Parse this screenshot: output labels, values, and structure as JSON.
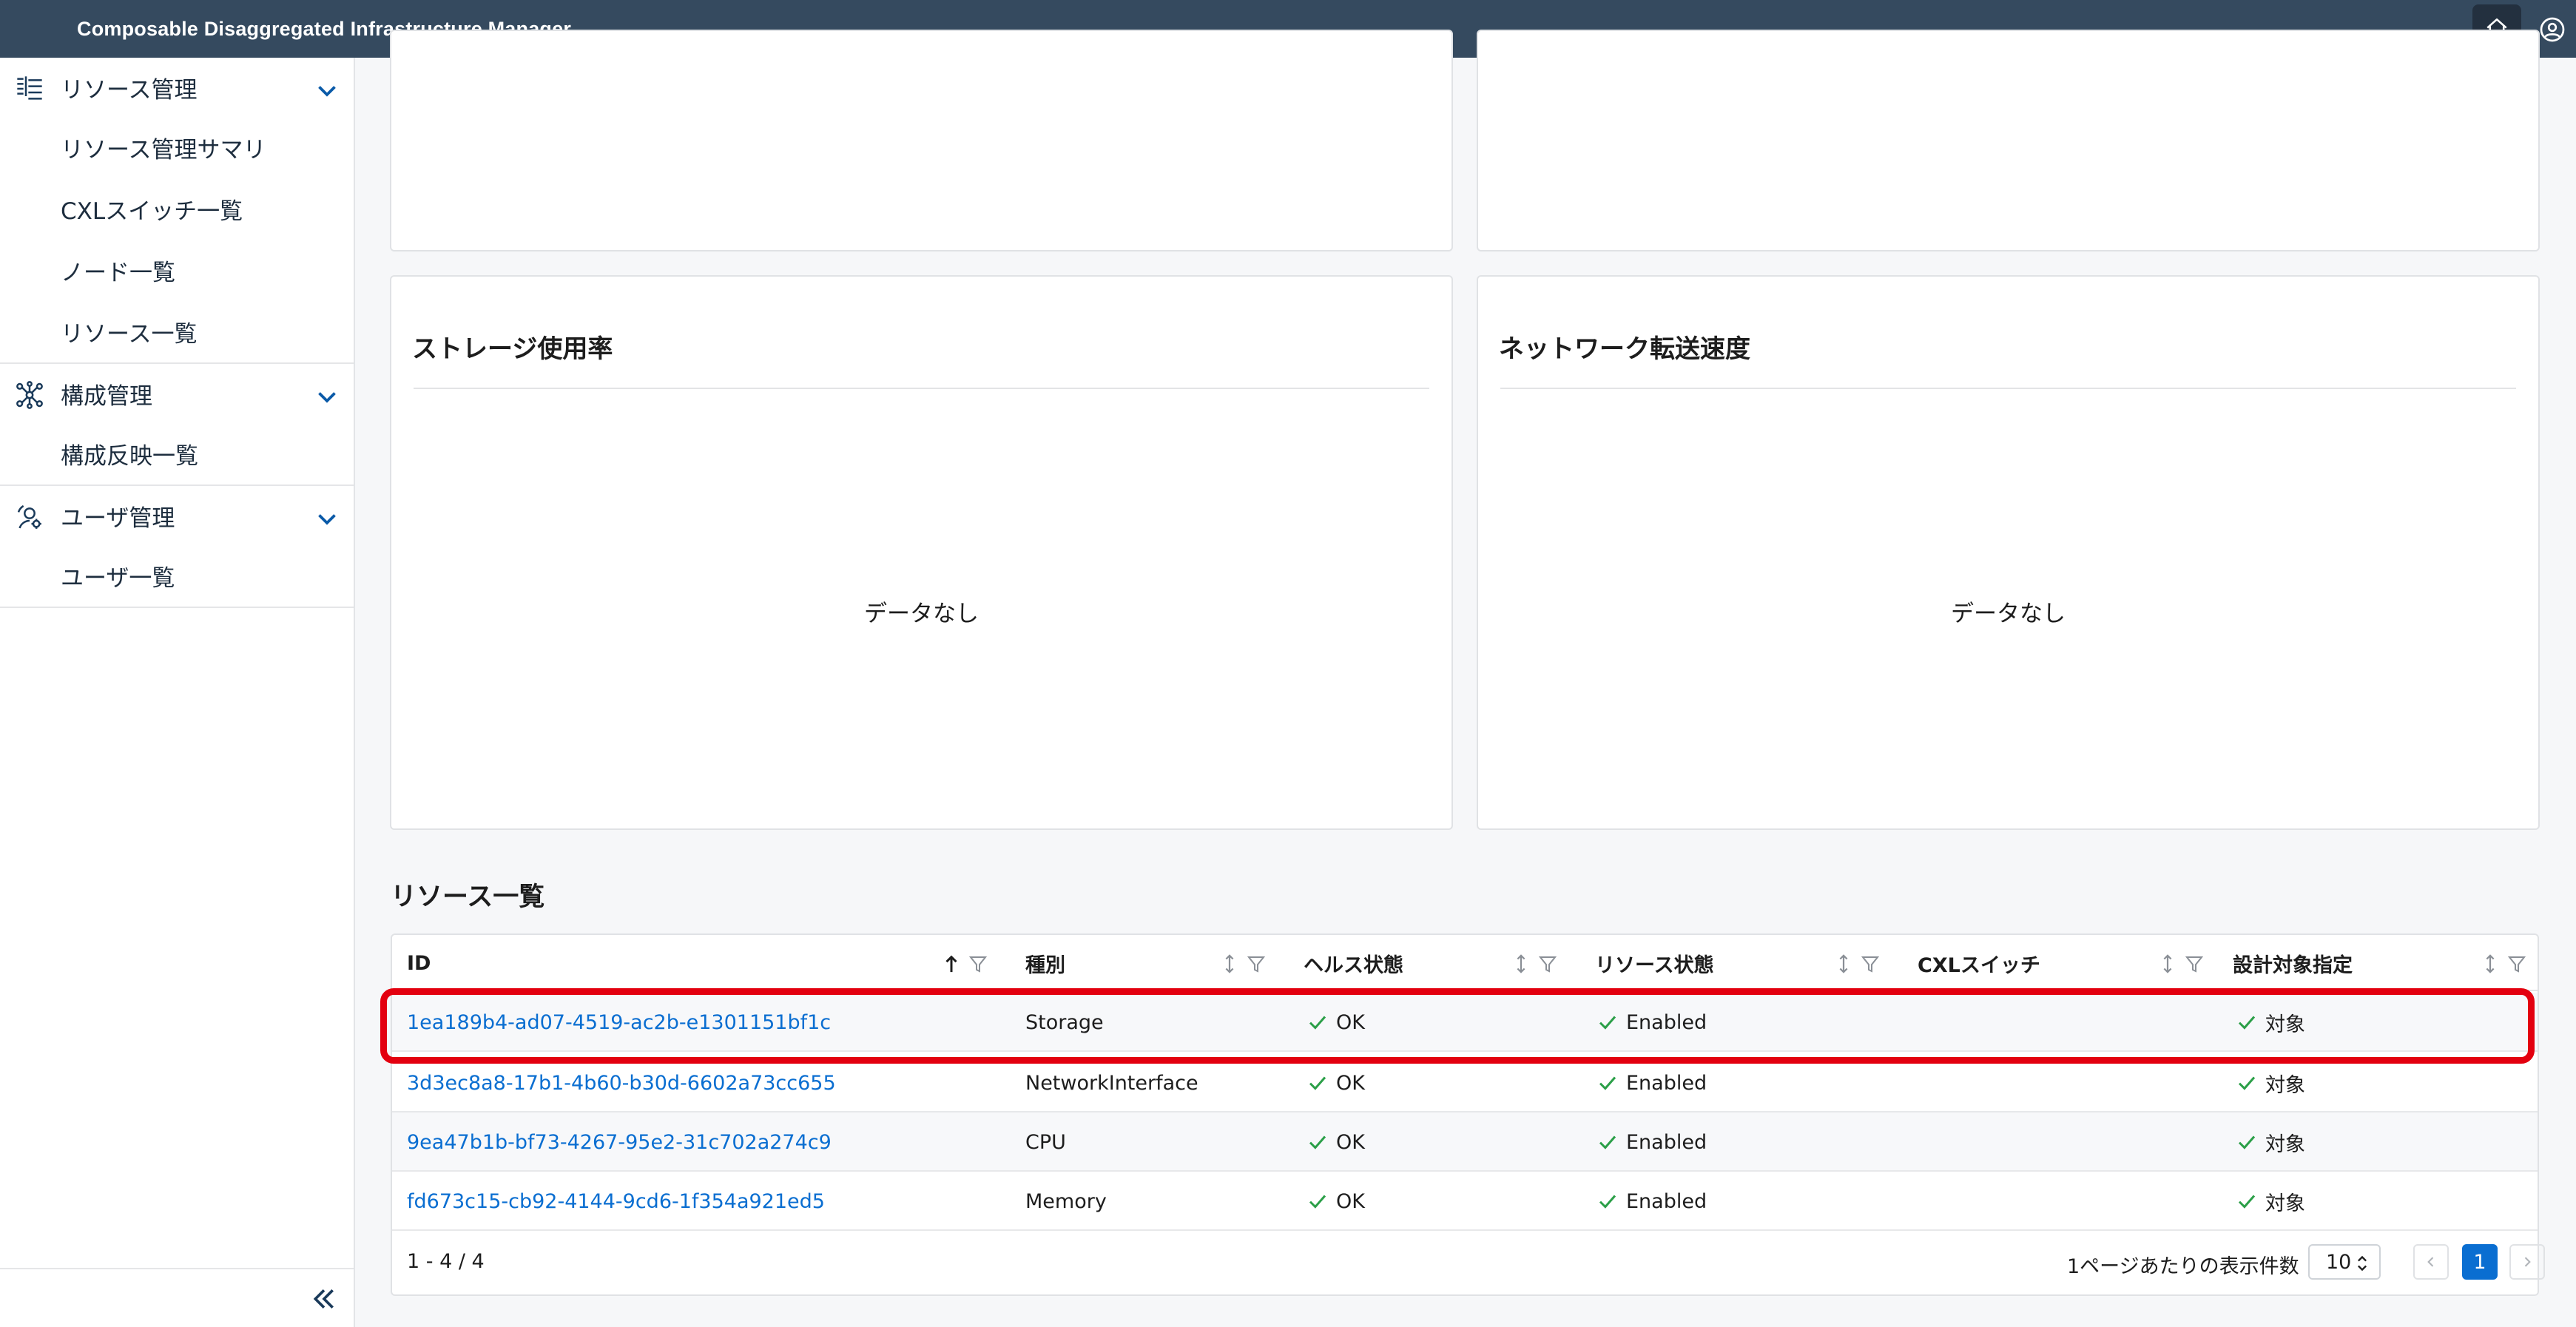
{
  "app": {
    "title": "Composable Disaggregated Infrastructure Manager"
  },
  "sidebar": {
    "groups": [
      {
        "label": "リソース管理",
        "icon": "resource-tree-icon",
        "items": [
          "リソース管理サマリ",
          "CXLスイッチ一覧",
          "ノード一覧",
          "リソース一覧"
        ]
      },
      {
        "label": "構成管理",
        "icon": "network-nodes-icon",
        "items": [
          "構成反映一覧"
        ]
      },
      {
        "label": "ユーザ管理",
        "icon": "user-gear-icon",
        "items": [
          "ユーザ一覧"
        ]
      }
    ]
  },
  "charts": [
    {
      "title": "ストレージ使用率",
      "empty": "データなし"
    },
    {
      "title": "ネットワーク転送速度",
      "empty": "データなし"
    }
  ],
  "resource_list": {
    "title": "リソース一覧",
    "columns": [
      "ID",
      "種別",
      "ヘルス状態",
      "リソース状態",
      "CXLスイッチ",
      "設計対象指定"
    ],
    "rows": [
      {
        "id": "1ea189b4-ad07-4519-ac2b-e1301151bf1c",
        "type": "Storage",
        "health": "OK",
        "state": "Enabled",
        "cxl": "",
        "target": "対象"
      },
      {
        "id": "3d3ec8a8-17b1-4b60-b30d-6602a73cc655",
        "type": "NetworkInterface",
        "health": "OK",
        "state": "Enabled",
        "cxl": "",
        "target": "対象"
      },
      {
        "id": "9ea47b1b-bf73-4267-95e2-31c702a274c9",
        "type": "CPU",
        "health": "OK",
        "state": "Enabled",
        "cxl": "",
        "target": "対象"
      },
      {
        "id": "fd673c15-cb92-4144-9cd6-1f354a921ed5",
        "type": "Memory",
        "health": "OK",
        "state": "Enabled",
        "cxl": "",
        "target": "対象"
      }
    ],
    "range": "1 - 4 / 4",
    "per_page_label": "1ページあたりの表示件数",
    "per_page_value": "10",
    "current_page": "1"
  },
  "colors": {
    "header_bg": "#354a5f",
    "link": "#0a6ed1",
    "ok_check": "#2b9f48",
    "highlight": "#e3000f"
  }
}
